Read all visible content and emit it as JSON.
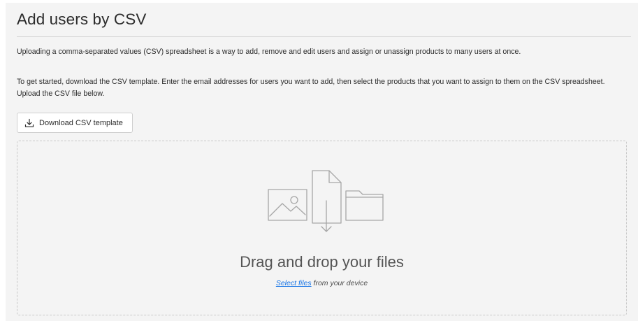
{
  "dialog": {
    "title": "Add users by CSV",
    "intro": "Uploading a comma-separated values (CSV) spreadsheet is a way to add, remove and edit users and assign or unassign products to many users at once.",
    "instructions": "To get started, download the CSV template. Enter the email addresses for users you want to add, then select the products that you want to assign to them on the CSV spreadsheet. Upload the CSV file below."
  },
  "download": {
    "label": "Download CSV template",
    "icon": "download-icon"
  },
  "dropzone": {
    "title": "Drag and drop your files",
    "select_link": "Select files",
    "select_suffix": " from your device",
    "icons": [
      "image-icon",
      "document-download-icon",
      "folder-icon"
    ]
  },
  "colors": {
    "link": "#1473e6",
    "background": "#f4f4f4",
    "text": "#2c2c2c",
    "illustration": "#a6a6a6"
  }
}
